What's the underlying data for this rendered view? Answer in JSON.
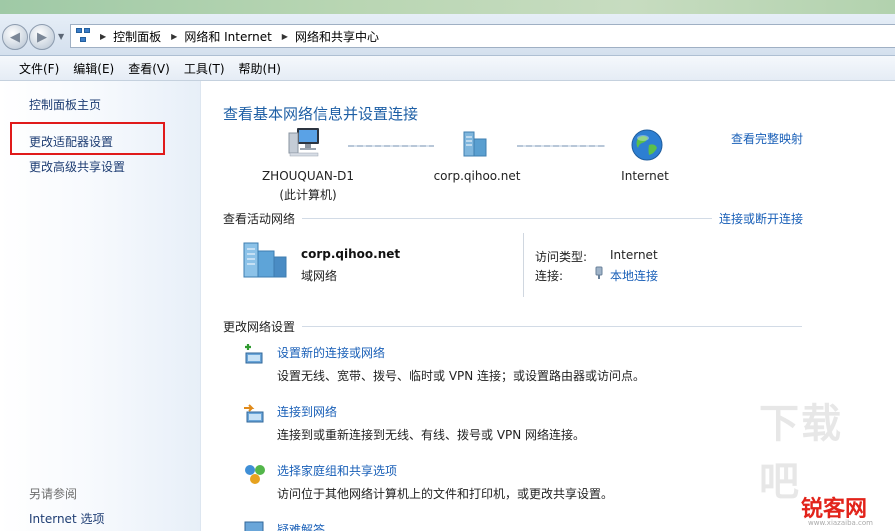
{
  "address_bar": {
    "nav_icon": "network-icon",
    "breadcrumbs": [
      "控制面板",
      "网络和 Internet",
      "网络和共享中心"
    ]
  },
  "menu": [
    "文件(F)",
    "编辑(E)",
    "查看(V)",
    "工具(T)",
    "帮助(H)"
  ],
  "sidebar": {
    "home": "控制面板主页",
    "adapter_settings": "更改适配器设置",
    "advanced_sharing": "更改高级共享设置",
    "see_also_heading": "另请参阅",
    "see_also_items": [
      "Internet 选项"
    ]
  },
  "main": {
    "title": "查看基本网络信息并设置连接",
    "full_map_link": "查看完整映射",
    "map": {
      "computer_name": "ZHOUQUAN-D1",
      "computer_sub": "(此计算机)",
      "domain": "corp.qihoo.net",
      "internet": "Internet"
    },
    "active_heading": "查看活动网络",
    "connect_link": "连接或断开连接",
    "active_network": {
      "name": "corp.qihoo.net",
      "type": "域网络",
      "access_type_key": "访问类型:",
      "access_type_value": "Internet",
      "connection_key": "连接:",
      "connection_value": "本地连接"
    },
    "change_heading": "更改网络设置",
    "tasks": [
      {
        "title": "设置新的连接或网络",
        "desc": "设置无线、宽带、拨号、临时或 VPN 连接；或设置路由器或访问点。",
        "icon": "new-connection-icon"
      },
      {
        "title": "连接到网络",
        "desc": "连接到或重新连接到无线、有线、拨号或 VPN 网络连接。",
        "icon": "connect-network-icon"
      },
      {
        "title": "选择家庭组和共享选项",
        "desc": "访问位于其他网络计算机上的文件和打印机，或更改共享设置。",
        "icon": "homegroup-icon"
      },
      {
        "title": "疑难解答",
        "desc": "",
        "icon": "troubleshoot-icon"
      }
    ]
  },
  "watermark": {
    "big": "下载吧",
    "brand": "锐客网",
    "sub": "www.xiazaiba.com"
  }
}
